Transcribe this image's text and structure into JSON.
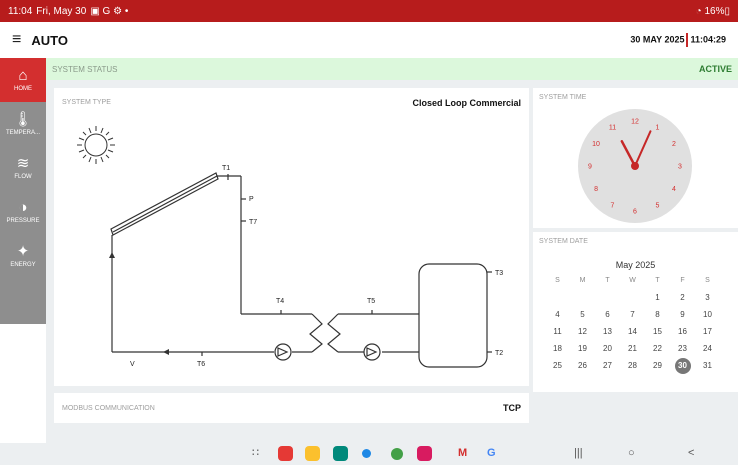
{
  "status_bar": {
    "time": "11:04",
    "date": "Fri, May 30",
    "icons": "▣ G ⚙ •",
    "battery": "◔ 16%▯"
  },
  "app_bar": {
    "menu_icon": "≡",
    "title": "AUTO",
    "date": "30 MAY 2025",
    "time": "11:04:29"
  },
  "sidebar": {
    "items": [
      {
        "label": "HOME",
        "icon": "⌂"
      },
      {
        "label": "TEMPERA...",
        "icon": "🌡"
      },
      {
        "label": "FLOW",
        "icon": "≋"
      },
      {
        "label": "PRESSURE",
        "icon": "◑"
      },
      {
        "label": "ENERGY",
        "icon": "✦"
      }
    ]
  },
  "system_status": {
    "label": "SYSTEM STATUS",
    "value": "ACTIVE"
  },
  "system_type": {
    "label": "SYSTEM TYPE",
    "value": "Closed Loop Commercial"
  },
  "diagram": {
    "labels": {
      "t1": "T1",
      "p": "P",
      "t7": "T7",
      "t4": "T4",
      "t5": "T5",
      "t3": "T3",
      "t2": "T2",
      "t6": "T6",
      "v": "V"
    }
  },
  "modbus": {
    "label": "MODBUS COMMUNICATION",
    "value": "TCP"
  },
  "system_time": {
    "label": "SYSTEM TIME",
    "hour": 11,
    "minute": 4,
    "numbers": [
      "12",
      "1",
      "2",
      "3",
      "4",
      "5",
      "6",
      "7",
      "8",
      "9",
      "10",
      "11"
    ]
  },
  "system_date": {
    "label": "SYSTEM DATE",
    "month_title": "May 2025",
    "weekdays": [
      "S",
      "M",
      "T",
      "W",
      "T",
      "F",
      "S"
    ],
    "weeks": [
      [
        "",
        "",
        "",
        "",
        "1",
        "2",
        "3"
      ],
      [
        "4",
        "5",
        "6",
        "7",
        "8",
        "9",
        "10"
      ],
      [
        "11",
        "12",
        "13",
        "14",
        "15",
        "16",
        "17"
      ],
      [
        "18",
        "19",
        "20",
        "21",
        "22",
        "23",
        "24"
      ],
      [
        "25",
        "26",
        "27",
        "28",
        "29",
        "30",
        "31"
      ]
    ],
    "selected": "30"
  },
  "nav_bar": {
    "recent": "|||",
    "home": "○",
    "back": "<",
    "apps_grid": "∷",
    "gmail": "M",
    "google": "G"
  }
}
